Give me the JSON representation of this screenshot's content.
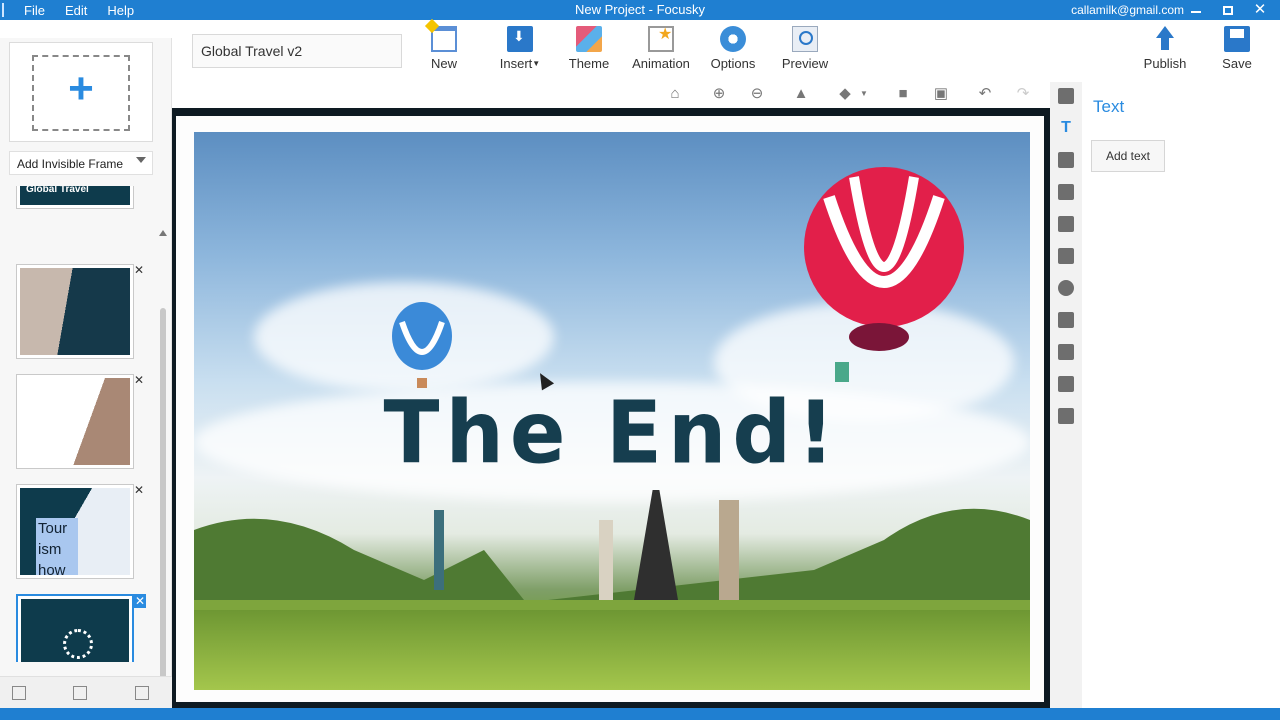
{
  "titlebar": {
    "menu": [
      "File",
      "Edit",
      "Help"
    ],
    "window_title": "New Project - Focusky",
    "account_email": "callamilk@gmail.com",
    "controls": {
      "minimize": "minimize",
      "maximize": "maximize",
      "close": "✕"
    }
  },
  "toolbar": {
    "project_name": "Global Travel v2",
    "buttons": [
      {
        "label": "New",
        "icon": "new-icon"
      },
      {
        "label": "Insert",
        "icon": "insert-icon"
      },
      {
        "label": "Theme",
        "icon": "theme-icon"
      },
      {
        "label": "Animation",
        "icon": "animation-icon"
      },
      {
        "label": "Options",
        "icon": "options-icon"
      },
      {
        "label": "Preview",
        "icon": "preview-icon"
      },
      {
        "label": "Publish",
        "icon": "publish-icon"
      },
      {
        "label": "Save",
        "icon": "save-icon"
      }
    ]
  },
  "left_panel": {
    "add_frame_icon": "+",
    "invisible_frame_label": "Add Invisible Frame",
    "thumbnails": [
      {
        "text": "Global Travel"
      },
      {
        "text": ""
      },
      {
        "text": ""
      },
      {
        "text": "Tour ism how"
      },
      {
        "text": "",
        "selected": true
      }
    ],
    "delete_glyph": "✕"
  },
  "canvas_tools": [
    "home-icon",
    "zoom-in-icon",
    "zoom-out-icon",
    "lock-icon",
    "fill-icon",
    "copy-icon",
    "paste-icon",
    "undo-icon",
    "redo-icon"
  ],
  "slide": {
    "headline": "The End!"
  },
  "right_strip": {
    "active_glyph": "T"
  },
  "properties": {
    "title": "Text",
    "add_text_label": "Add text"
  },
  "colors": {
    "accent": "#1f7fd1",
    "headline": "#163e4f"
  }
}
